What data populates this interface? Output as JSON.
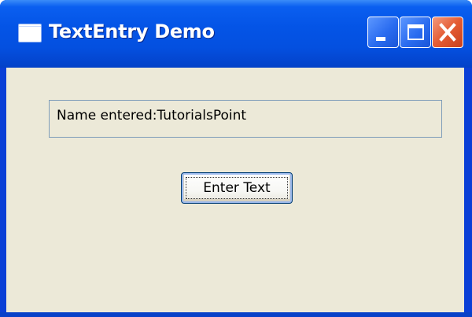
{
  "window": {
    "title": "TextEntry Demo",
    "app_icon": "window-icon",
    "controls": {
      "minimize_icon": "minimize-icon",
      "maximize_icon": "maximize-icon",
      "close_icon": "close-icon"
    },
    "colors": {
      "titlebar": "#0454e6",
      "client_background": "#ece9d8",
      "close_button": "#e45b33",
      "field_border": "#7f9db9",
      "button_border": "#003c74"
    }
  },
  "form": {
    "display_text": "Name entered:TutorialsPoint",
    "enter_button_label": "Enter Text"
  }
}
